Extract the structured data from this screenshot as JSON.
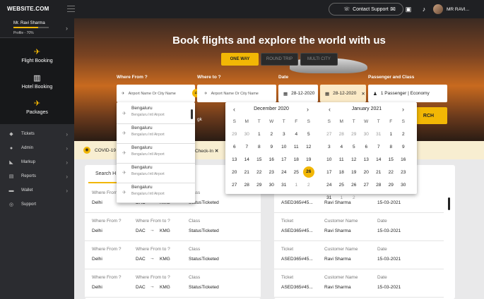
{
  "topbar": {
    "logo": "WEBSITE.COM",
    "support": "Contact Support",
    "user": "MR RAVI..."
  },
  "profile": {
    "name": "Mr. Ravi Sharma",
    "progress": 0.7,
    "percent_text": "Profile - 70%"
  },
  "booking": [
    {
      "label": "Flight Booking",
      "icon": "plane-icon"
    },
    {
      "label": "Hotel Booking",
      "icon": "hotel-icon"
    },
    {
      "label": "Packages",
      "icon": "package-icon"
    }
  ],
  "menu": [
    {
      "label": "Tickets",
      "icon": "ticket-icon"
    },
    {
      "label": "Admin",
      "icon": "user-icon"
    },
    {
      "label": "Markup",
      "icon": "tag-icon"
    },
    {
      "label": "Reports",
      "icon": "document-icon"
    },
    {
      "label": "Wallet",
      "icon": "wallet-icon"
    },
    {
      "label": "Support",
      "icon": "headset-icon"
    }
  ],
  "hero": {
    "headline": "Book flights and explore the world with us",
    "tabs": [
      {
        "label": "ONE WAY",
        "active": true
      },
      {
        "label": "ROUND TRIP",
        "active": false
      },
      {
        "label": "MULTI CITY",
        "active": false
      }
    ],
    "labels": {
      "from": "Where From ?",
      "to": "Where to ?",
      "date": "Date",
      "pax": "Passenger and Class"
    },
    "from_placeholder": "Airport Name Or City Name",
    "to_placeholder": "Airport Name Or City Name",
    "date1": "28-12-2020",
    "date2": "28-12-2020",
    "pax": "1 Passenger | Economy",
    "search": "SEARCH",
    "search_visible": "RCH",
    "partial_to": "gk"
  },
  "notice": {
    "text": "COVID-19",
    "partial": "Check-In"
  },
  "dropdown": [
    {
      "city": "Bengaluru",
      "airport": "Bengaluru Intl Airport"
    },
    {
      "city": "Bengaluru",
      "airport": "Bengaluru Intl Airport"
    },
    {
      "city": "Bengaluru",
      "airport": "Bengaluru Intl Airport"
    },
    {
      "city": "Bengaluru",
      "airport": "Bengaluru Intl Airport"
    },
    {
      "city": "Bengaluru",
      "airport": "Bengaluru Intl Airport"
    }
  ],
  "calendar": {
    "weekdays": [
      "S",
      "M",
      "T",
      "W",
      "T",
      "F",
      "S"
    ],
    "months": [
      {
        "title": "December 2020",
        "days": [
          "29",
          "30",
          "1",
          "2",
          "3",
          "4",
          "5",
          "6",
          "7",
          "8",
          "9",
          "10",
          "11",
          "12",
          "13",
          "14",
          "15",
          "16",
          "17",
          "18",
          "19",
          "20",
          "21",
          "22",
          "23",
          "24",
          "25",
          "26",
          "27",
          "28",
          "29",
          "30",
          "31",
          "1",
          "2"
        ],
        "muted": [
          0,
          1,
          33,
          34
        ],
        "selected": 27
      },
      {
        "title": "January 2021",
        "days": [
          "27",
          "28",
          "29",
          "30",
          "31",
          "1",
          "2",
          "3",
          "4",
          "5",
          "6",
          "7",
          "8",
          "9",
          "10",
          "11",
          "12",
          "13",
          "14",
          "15",
          "16",
          "17",
          "18",
          "19",
          "20",
          "21",
          "22",
          "23",
          "24",
          "25",
          "26",
          "27",
          "28",
          "29",
          "30",
          "31",
          "1",
          "2"
        ],
        "muted": [
          0,
          1,
          2,
          3,
          4,
          36,
          37
        ],
        "selected": -1
      }
    ]
  },
  "left_panel": {
    "tab": "Search H",
    "rows": [
      {
        "from_label": "Where From ?",
        "to_label": "Where From to ?",
        "class_label": "Class",
        "from": "Delhi",
        "to": "DAC",
        "dest": "KMG",
        "status": "StatusTicketed"
      },
      {
        "from_label": "Where From ?",
        "to_label": "Where From to ?",
        "class_label": "Class",
        "from": "Delhi",
        "to": "DAC",
        "dest": "KMG",
        "status": "StatusTicketed"
      },
      {
        "from_label": "Where From ?",
        "to_label": "Where From to ?",
        "class_label": "Class",
        "from": "Delhi",
        "to": "DAC",
        "dest": "KMG",
        "status": "StatusTicketed"
      },
      {
        "from_label": "Where From ?",
        "to_label": "Where From to ?",
        "class_label": "Class",
        "from": "Delhi",
        "to": "DAC",
        "dest": "KMG",
        "status": "StatusTicketed"
      }
    ]
  },
  "right_panel": {
    "rows": [
      {
        "t_label": "Ticket",
        "c_label": "Customer Name",
        "d_label": "Date",
        "ticket": "ASED365#45...",
        "customer": "Ravi Sharma",
        "date": "15-03-2021"
      },
      {
        "t_label": "Ticket",
        "c_label": "Customer Name",
        "d_label": "Date",
        "ticket": "ASED365#45...",
        "customer": "Ravi Sharma",
        "date": "15-03-2021"
      },
      {
        "t_label": "Ticket",
        "c_label": "Customer Name",
        "d_label": "Date",
        "ticket": "ASED365#45...",
        "customer": "Ravi Sharma",
        "date": "15-03-2021"
      },
      {
        "t_label": "Ticket",
        "c_label": "Customer Name",
        "d_label": "Date",
        "ticket": "ASED365#45...",
        "customer": "Ravi Sharma",
        "date": "15-03-2021"
      }
    ]
  },
  "colors": {
    "accent": "#f2b705",
    "dark": "#1f2023",
    "sidebar": "#2b2c30"
  }
}
